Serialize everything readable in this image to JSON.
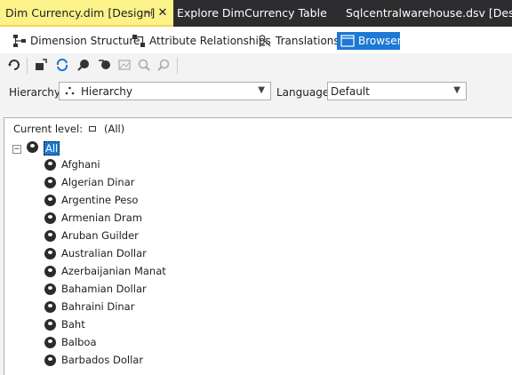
{
  "doc_tabs": [
    {
      "label": "Dim Currency.dim [Design]",
      "active": true
    },
    {
      "label": "Explore DimCurrency Table",
      "active": false
    },
    {
      "label": "Sqlcentralwarehouse.dsv [Design]",
      "active": false
    }
  ],
  "doc_tab_pin": "⊣",
  "doc_tab_close": "✕",
  "designer_tabs": [
    {
      "label": "Dimension Structure",
      "icon": "dimension-structure-icon"
    },
    {
      "label": "Attribute Relationships",
      "icon": "attribute-relationships-icon"
    },
    {
      "label": "Translations",
      "icon": "translations-icon"
    },
    {
      "label": "Browser",
      "icon": "browser-icon",
      "active": true
    }
  ],
  "toolbar": {
    "buttons": [
      "reconnect-icon",
      "process-icon",
      "refresh-icon",
      "filter-icon",
      "reset-icon",
      "image-icon",
      "zoom-in-icon",
      "zoom-out-icon"
    ]
  },
  "filters": {
    "hierarchy_label": "Hierarchy:",
    "hierarchy_value": "Hierarchy",
    "language_label": "Language:",
    "language_value": "Default"
  },
  "browser": {
    "current_level_label": "Current level:",
    "current_level_value": "(All)",
    "root_label": "All",
    "members": [
      "Afghani",
      "Algerian Dinar",
      "Argentine Peso",
      "Armenian Dram",
      "Aruban Guilder",
      "Australian Dollar",
      "Azerbaijanian Manat",
      "Bahamian Dollar",
      "Bahraini Dinar",
      "Baht",
      "Balboa",
      "Barbados Dollar"
    ]
  },
  "colors": {
    "accent": "#1d79d3",
    "active_doc_tab": "#fbf28a",
    "tab_strip": "#2d2d30"
  }
}
